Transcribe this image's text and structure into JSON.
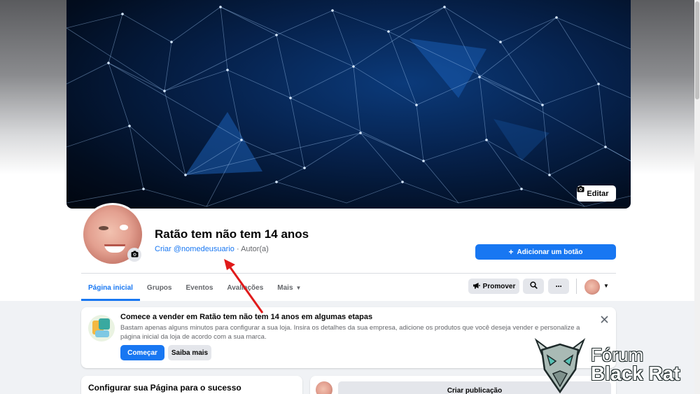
{
  "cover": {
    "edit_label": "Editar"
  },
  "profile": {
    "name": "Ratão tem não tem 14 anos",
    "username_link": "Criar @nomedeusuario",
    "separator": " · ",
    "role": "Autor(a)"
  },
  "actions": {
    "add_button": "Adicionar um botão",
    "promote": "Promover"
  },
  "tabs": [
    {
      "label": "Página inicial"
    },
    {
      "label": "Grupos"
    },
    {
      "label": "Eventos"
    },
    {
      "label": "Avaliações"
    },
    {
      "label": "Mais"
    }
  ],
  "sell_card": {
    "title": "Comece a vender em Ratão tem não tem 14 anos em algumas etapas",
    "description": "Bastam apenas alguns minutos para configurar a sua loja. Insira os detalhes da sua empresa, adicione os produtos que você deseja vender e personalize a página inicial da loja de acordo com a sua marca.",
    "start_button": "Começar",
    "more_button": "Saiba mais"
  },
  "setup_card": {
    "title": "Configurar sua Página para o sucesso"
  },
  "post_card": {
    "create_label": "Criar publicação"
  },
  "watermark": {
    "line1": "Fórum",
    "line2": "Black Rat"
  },
  "colors": {
    "accent": "#1877f2",
    "annotation_arrow": "#e01a1a",
    "background": "#f0f2f5"
  }
}
